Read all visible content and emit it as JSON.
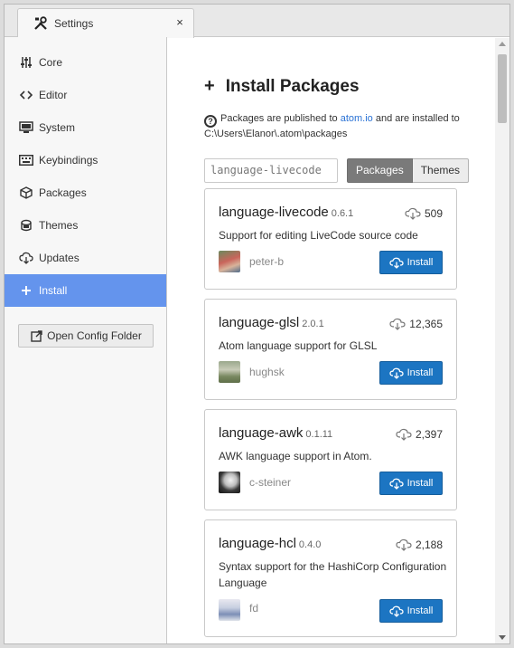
{
  "tab": {
    "title": "Settings",
    "icon": "tools-icon",
    "close": "×"
  },
  "sidebar": {
    "items": [
      {
        "label": "Core",
        "icon": "sliders-icon"
      },
      {
        "label": "Editor",
        "icon": "code-icon"
      },
      {
        "label": "System",
        "icon": "monitor-icon"
      },
      {
        "label": "Keybindings",
        "icon": "keyboard-icon"
      },
      {
        "label": "Packages",
        "icon": "package-icon"
      },
      {
        "label": "Themes",
        "icon": "paintcan-icon"
      },
      {
        "label": "Updates",
        "icon": "cloud-download-icon"
      },
      {
        "label": "Install",
        "icon": "plus-icon",
        "active": true
      }
    ],
    "config_button": "Open Config Folder"
  },
  "main": {
    "title": "Install Packages",
    "title_icon": "+",
    "info_prefix": "Packages are published to ",
    "info_link": "atom.io",
    "info_suffix": " and are installed to C:\\Users\\Elanor\\.atom\\packages",
    "search_value": "language-livecode",
    "toggle": {
      "packages": "Packages",
      "themes": "Themes"
    },
    "install_label": "Install",
    "packages": [
      {
        "name": "language-livecode",
        "version": "0.6.1",
        "downloads": "509",
        "description": "Support for editing LiveCode source code",
        "author": "peter-b"
      },
      {
        "name": "language-glsl",
        "version": "2.0.1",
        "downloads": "12,365",
        "description": "Atom language support for GLSL",
        "author": "hughsk"
      },
      {
        "name": "language-awk",
        "version": "0.1.11",
        "downloads": "2,397",
        "description": "AWK language support in Atom.",
        "author": "c-steiner"
      },
      {
        "name": "language-hcl",
        "version": "0.4.0",
        "downloads": "2,188",
        "description": "Syntax support for the HashiCorp Configuration Language",
        "author": "fd"
      }
    ]
  },
  "colors": {
    "accent": "#6494ed",
    "install": "#1c75c2",
    "link": "#2a72d5"
  }
}
